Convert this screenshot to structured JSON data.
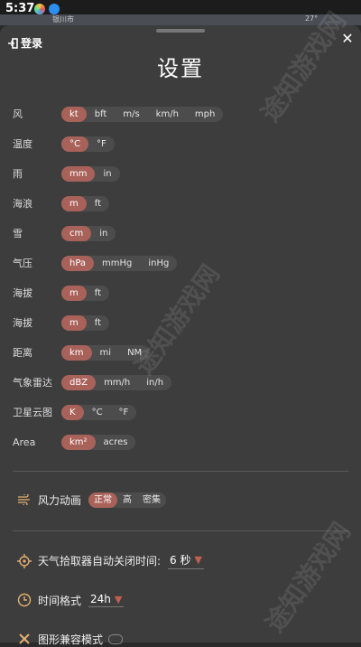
{
  "status": {
    "time": "5:37",
    "map_city": "银川市",
    "map_temp": "27°"
  },
  "header": {
    "login": "登录",
    "title": "设置",
    "close": "✕"
  },
  "units": [
    {
      "label": "风",
      "options": [
        "kt",
        "bft",
        "m/s",
        "km/h",
        "mph"
      ],
      "selected": 0
    },
    {
      "label": "温度",
      "options": [
        "°C",
        "°F"
      ],
      "selected": 0
    },
    {
      "label": "雨",
      "options": [
        "mm",
        "in"
      ],
      "selected": 0
    },
    {
      "label": "海浪",
      "options": [
        "m",
        "ft"
      ],
      "selected": 0
    },
    {
      "label": "雪",
      "options": [
        "cm",
        "in"
      ],
      "selected": 0
    },
    {
      "label": "气压",
      "options": [
        "hPa",
        "mmHg",
        "inHg"
      ],
      "selected": 0
    },
    {
      "label": "海拔",
      "options": [
        "m",
        "ft"
      ],
      "selected": 0
    },
    {
      "label": "海拔",
      "options": [
        "m",
        "ft"
      ],
      "selected": 0
    },
    {
      "label": "距离",
      "options": [
        "km",
        "mi",
        "NM"
      ],
      "selected": 0
    },
    {
      "label": "气象雷达",
      "options": [
        "dBZ",
        "mm/h",
        "in/h"
      ],
      "selected": 0
    },
    {
      "label": "卫星云图",
      "options": [
        "K",
        "°C",
        "°F"
      ],
      "selected": 0
    },
    {
      "label": "Area",
      "options": [
        "km²",
        "acres"
      ],
      "selected": 0
    }
  ],
  "wind_anim": {
    "label": "风力动画",
    "options": [
      "正常",
      "高",
      "密集"
    ],
    "selected": 0,
    "icon": "wind-icon"
  },
  "picker": {
    "label": "天气拾取器自动关闭时间:",
    "value": "6 秒",
    "icon": "crosshair-icon"
  },
  "time_format": {
    "label": "时间格式",
    "value": "24h",
    "icon": "clock-icon"
  },
  "graphics": {
    "label": "图形兼容模式",
    "icon": "tools-icon"
  },
  "watermark": {
    "text": "途知游戏网"
  },
  "colors": {
    "accent": "#a8625a",
    "sheet": "#3e3d3d",
    "pill": "#4d4c4c"
  }
}
